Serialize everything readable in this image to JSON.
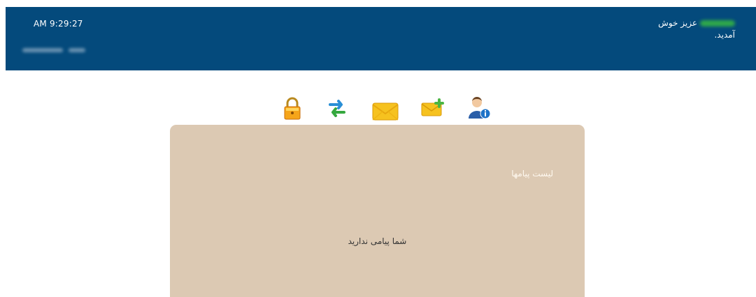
{
  "header": {
    "time": "AM 9:29:27",
    "welcome_line1": "عزیز خوش",
    "welcome_line2": "آمدید."
  },
  "toolbar": {
    "icons": [
      "lock-icon",
      "refresh-icon",
      "inbox-icon",
      "new-message-icon",
      "user-info-icon"
    ]
  },
  "messages_panel": {
    "title": "لیست پیامها",
    "empty_text": "شما پیامی ندارید"
  },
  "colors": {
    "header_bg": "#044a7c",
    "panel_bg": "#dcc9b3",
    "accent_yellow": "#f6c21f"
  }
}
